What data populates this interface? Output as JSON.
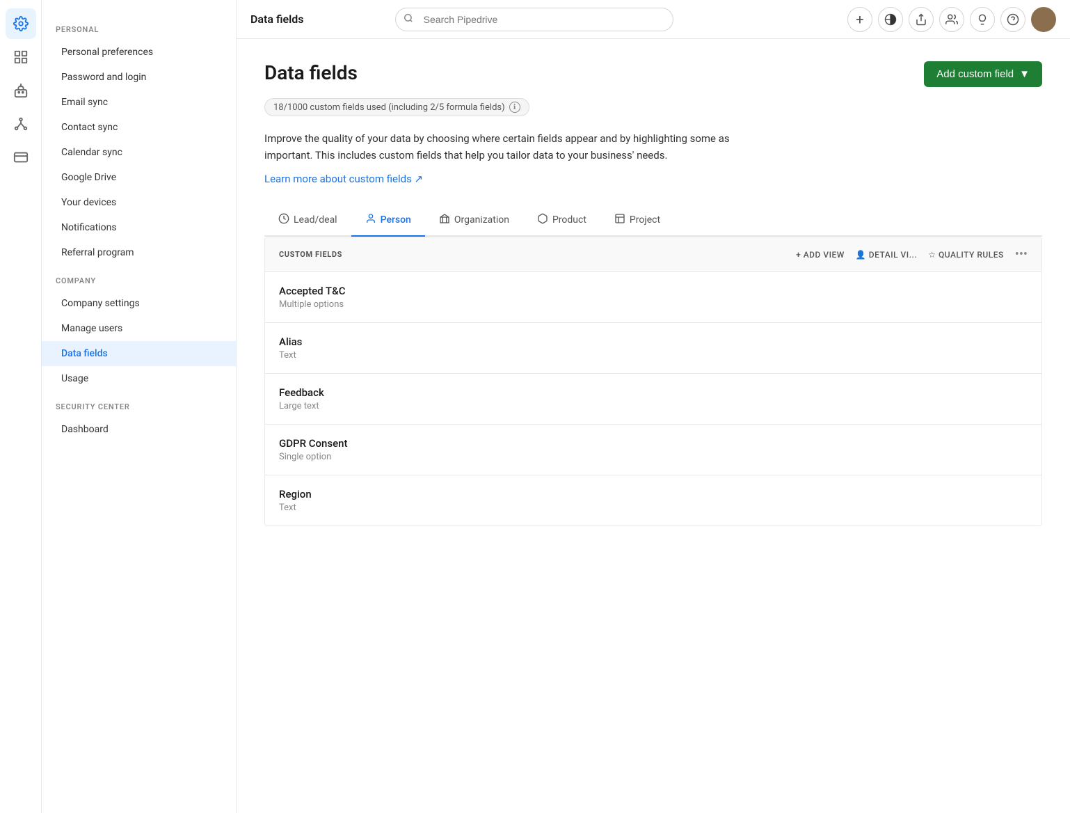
{
  "window_title": "Data fields",
  "top_bar": {
    "title": "Data fields",
    "search_placeholder": "Search Pipedrive"
  },
  "icon_sidebar": {
    "items": [
      {
        "name": "gear-icon",
        "symbol": "⚙",
        "active": true
      },
      {
        "name": "grid-icon",
        "symbol": "⊞",
        "active": false
      },
      {
        "name": "robot-icon",
        "symbol": "🤖",
        "active": false
      },
      {
        "name": "hierarchy-icon",
        "symbol": "⌂",
        "active": false
      },
      {
        "name": "card-icon",
        "symbol": "▬",
        "active": false
      }
    ]
  },
  "nav_sidebar": {
    "personal_section_label": "PERSONAL",
    "personal_items": [
      {
        "label": "Personal preferences",
        "active": false
      },
      {
        "label": "Password and login",
        "active": false
      },
      {
        "label": "Email sync",
        "active": false
      },
      {
        "label": "Contact sync",
        "active": false
      },
      {
        "label": "Calendar sync",
        "active": false
      },
      {
        "label": "Google Drive",
        "active": false
      },
      {
        "label": "Your devices",
        "active": false
      },
      {
        "label": "Notifications",
        "active": false
      },
      {
        "label": "Referral program",
        "active": false
      }
    ],
    "company_section_label": "COMPANY",
    "company_items": [
      {
        "label": "Company settings",
        "active": false
      },
      {
        "label": "Manage users",
        "active": false
      },
      {
        "label": "Data fields",
        "active": true
      },
      {
        "label": "Usage",
        "active": false
      }
    ],
    "security_section_label": "SECURITY CENTER",
    "security_items": [
      {
        "label": "Dashboard",
        "active": false
      }
    ]
  },
  "page": {
    "title": "Data fields",
    "add_button_label": "Add custom field",
    "usage_badge": "18/1000 custom fields used (including 2/5 formula fields)",
    "description": "Improve the quality of your data by choosing where certain fields appear and by highlighting some as important. This includes custom fields that help you tailor data to your business' needs.",
    "learn_more_label": "Learn more about custom fields ↗",
    "tabs": [
      {
        "label": "Lead/deal",
        "icon": "💲",
        "active": false
      },
      {
        "label": "Person",
        "icon": "👤",
        "active": true
      },
      {
        "label": "Organization",
        "icon": "🏢",
        "active": false
      },
      {
        "label": "Product",
        "icon": "📦",
        "active": false
      },
      {
        "label": "Project",
        "icon": "📋",
        "active": false
      }
    ],
    "table": {
      "column_label": "CUSTOM FIELDS",
      "actions": [
        {
          "label": "+ ADD VIEW"
        },
        {
          "label": "👤 DETAIL VI..."
        },
        {
          "label": "☆ QUALITY RULES"
        },
        {
          "label": "•••"
        }
      ],
      "fields": [
        {
          "name": "Accepted T&C",
          "type": "Multiple options"
        },
        {
          "name": "Alias",
          "type": "Text"
        },
        {
          "name": "Feedback",
          "type": "Large text"
        },
        {
          "name": "GDPR Consent",
          "type": "Single option"
        },
        {
          "name": "Region",
          "type": "Text"
        }
      ]
    }
  }
}
